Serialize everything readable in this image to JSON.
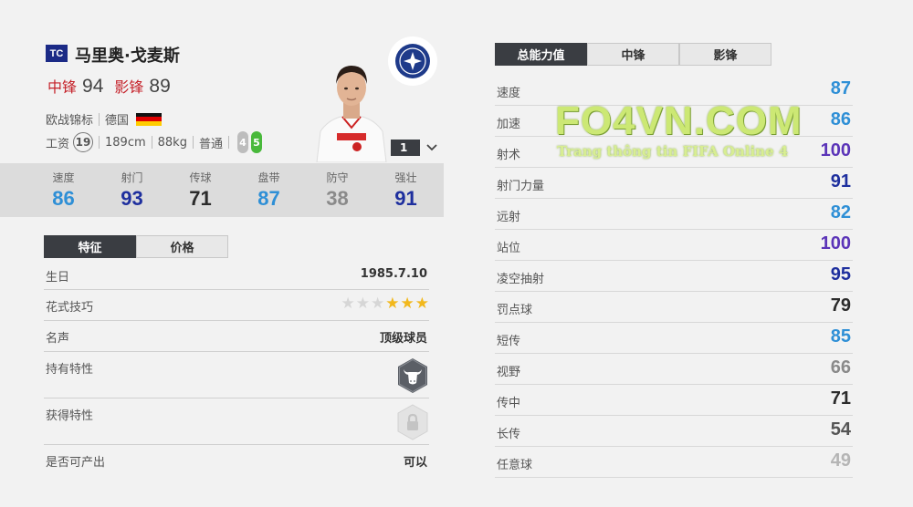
{
  "colors": {
    "accent_red": "#c5232b",
    "stat_blue": "#2e8fd6",
    "stat_navy": "#1e2f9e",
    "stat_purple": "#5b34b8",
    "stat_dark": "#2b2b2b",
    "stat_gray": "#8a8a8a",
    "stat_lightgray": "#b5b5b5",
    "season_badge": "#1b2a86",
    "tab_active_bg": "#3a3d42"
  },
  "player": {
    "season_badge": "TC",
    "name": "马里奥·戈麦斯",
    "positions": [
      {
        "name": "中锋",
        "rating": "94"
      },
      {
        "name": "影锋",
        "rating": "89"
      }
    ],
    "league": "欧战锦标",
    "nation": "德国",
    "salary_label": "工资",
    "salary": "19",
    "height": "189cm",
    "weight": "88kg",
    "body_type": "普通",
    "weak_foot": "4",
    "strong_foot": "5",
    "level": "1"
  },
  "stats_band": [
    {
      "label": "速度",
      "value": "86",
      "color": "#2e8fd6"
    },
    {
      "label": "射门",
      "value": "93",
      "color": "#1e2f9e"
    },
    {
      "label": "传球",
      "value": "71",
      "color": "#2b2b2b"
    },
    {
      "label": "盘带",
      "value": "87",
      "color": "#2e8fd6"
    },
    {
      "label": "防守",
      "value": "38",
      "color": "#8a8a8a"
    },
    {
      "label": "强壮",
      "value": "91",
      "color": "#1e2f9e"
    }
  ],
  "left_tabs": [
    "特征",
    "价格"
  ],
  "traits": {
    "birthday_label": "生日",
    "birthday": "1985.7.10",
    "skill_moves_label": "花式技巧",
    "skill_moves_stars": 3,
    "skill_moves_max": 6,
    "reputation_label": "名声",
    "reputation": "顶级球员",
    "owned_traits_label": "持有特性",
    "owned_trait_icon": "bull-icon",
    "acquired_traits_label": "获得特性",
    "acquired_trait_icon": "lock-icon",
    "export_label": "是否可产出",
    "export_value": "可以"
  },
  "right_tabs": [
    "总能力值",
    "中锋",
    "影锋"
  ],
  "attributes": [
    {
      "label": "速度",
      "value": "87",
      "color": "#2e8fd6"
    },
    {
      "label": "加速",
      "value": "86",
      "color": "#2e8fd6"
    },
    {
      "label": "射术",
      "value": "100",
      "color": "#5b34b8"
    },
    {
      "label": "射门力量",
      "value": "91",
      "color": "#1e2f9e"
    },
    {
      "label": "远射",
      "value": "82",
      "color": "#2e8fd6"
    },
    {
      "label": "站位",
      "value": "100",
      "color": "#5b34b8"
    },
    {
      "label": "凌空抽射",
      "value": "95",
      "color": "#1e2f9e"
    },
    {
      "label": "罚点球",
      "value": "79",
      "color": "#2b2b2b"
    },
    {
      "label": "短传",
      "value": "85",
      "color": "#2e8fd6"
    },
    {
      "label": "视野",
      "value": "66",
      "color": "#8a8a8a"
    },
    {
      "label": "传中",
      "value": "71",
      "color": "#2b2b2b"
    },
    {
      "label": "长传",
      "value": "54",
      "color": "#555555"
    },
    {
      "label": "任意球",
      "value": "49",
      "color": "#b5b5b5"
    }
  ],
  "watermark": {
    "title": "FO4VN.COM",
    "subtitle": "Trang thông tin FIFA Online 4"
  }
}
